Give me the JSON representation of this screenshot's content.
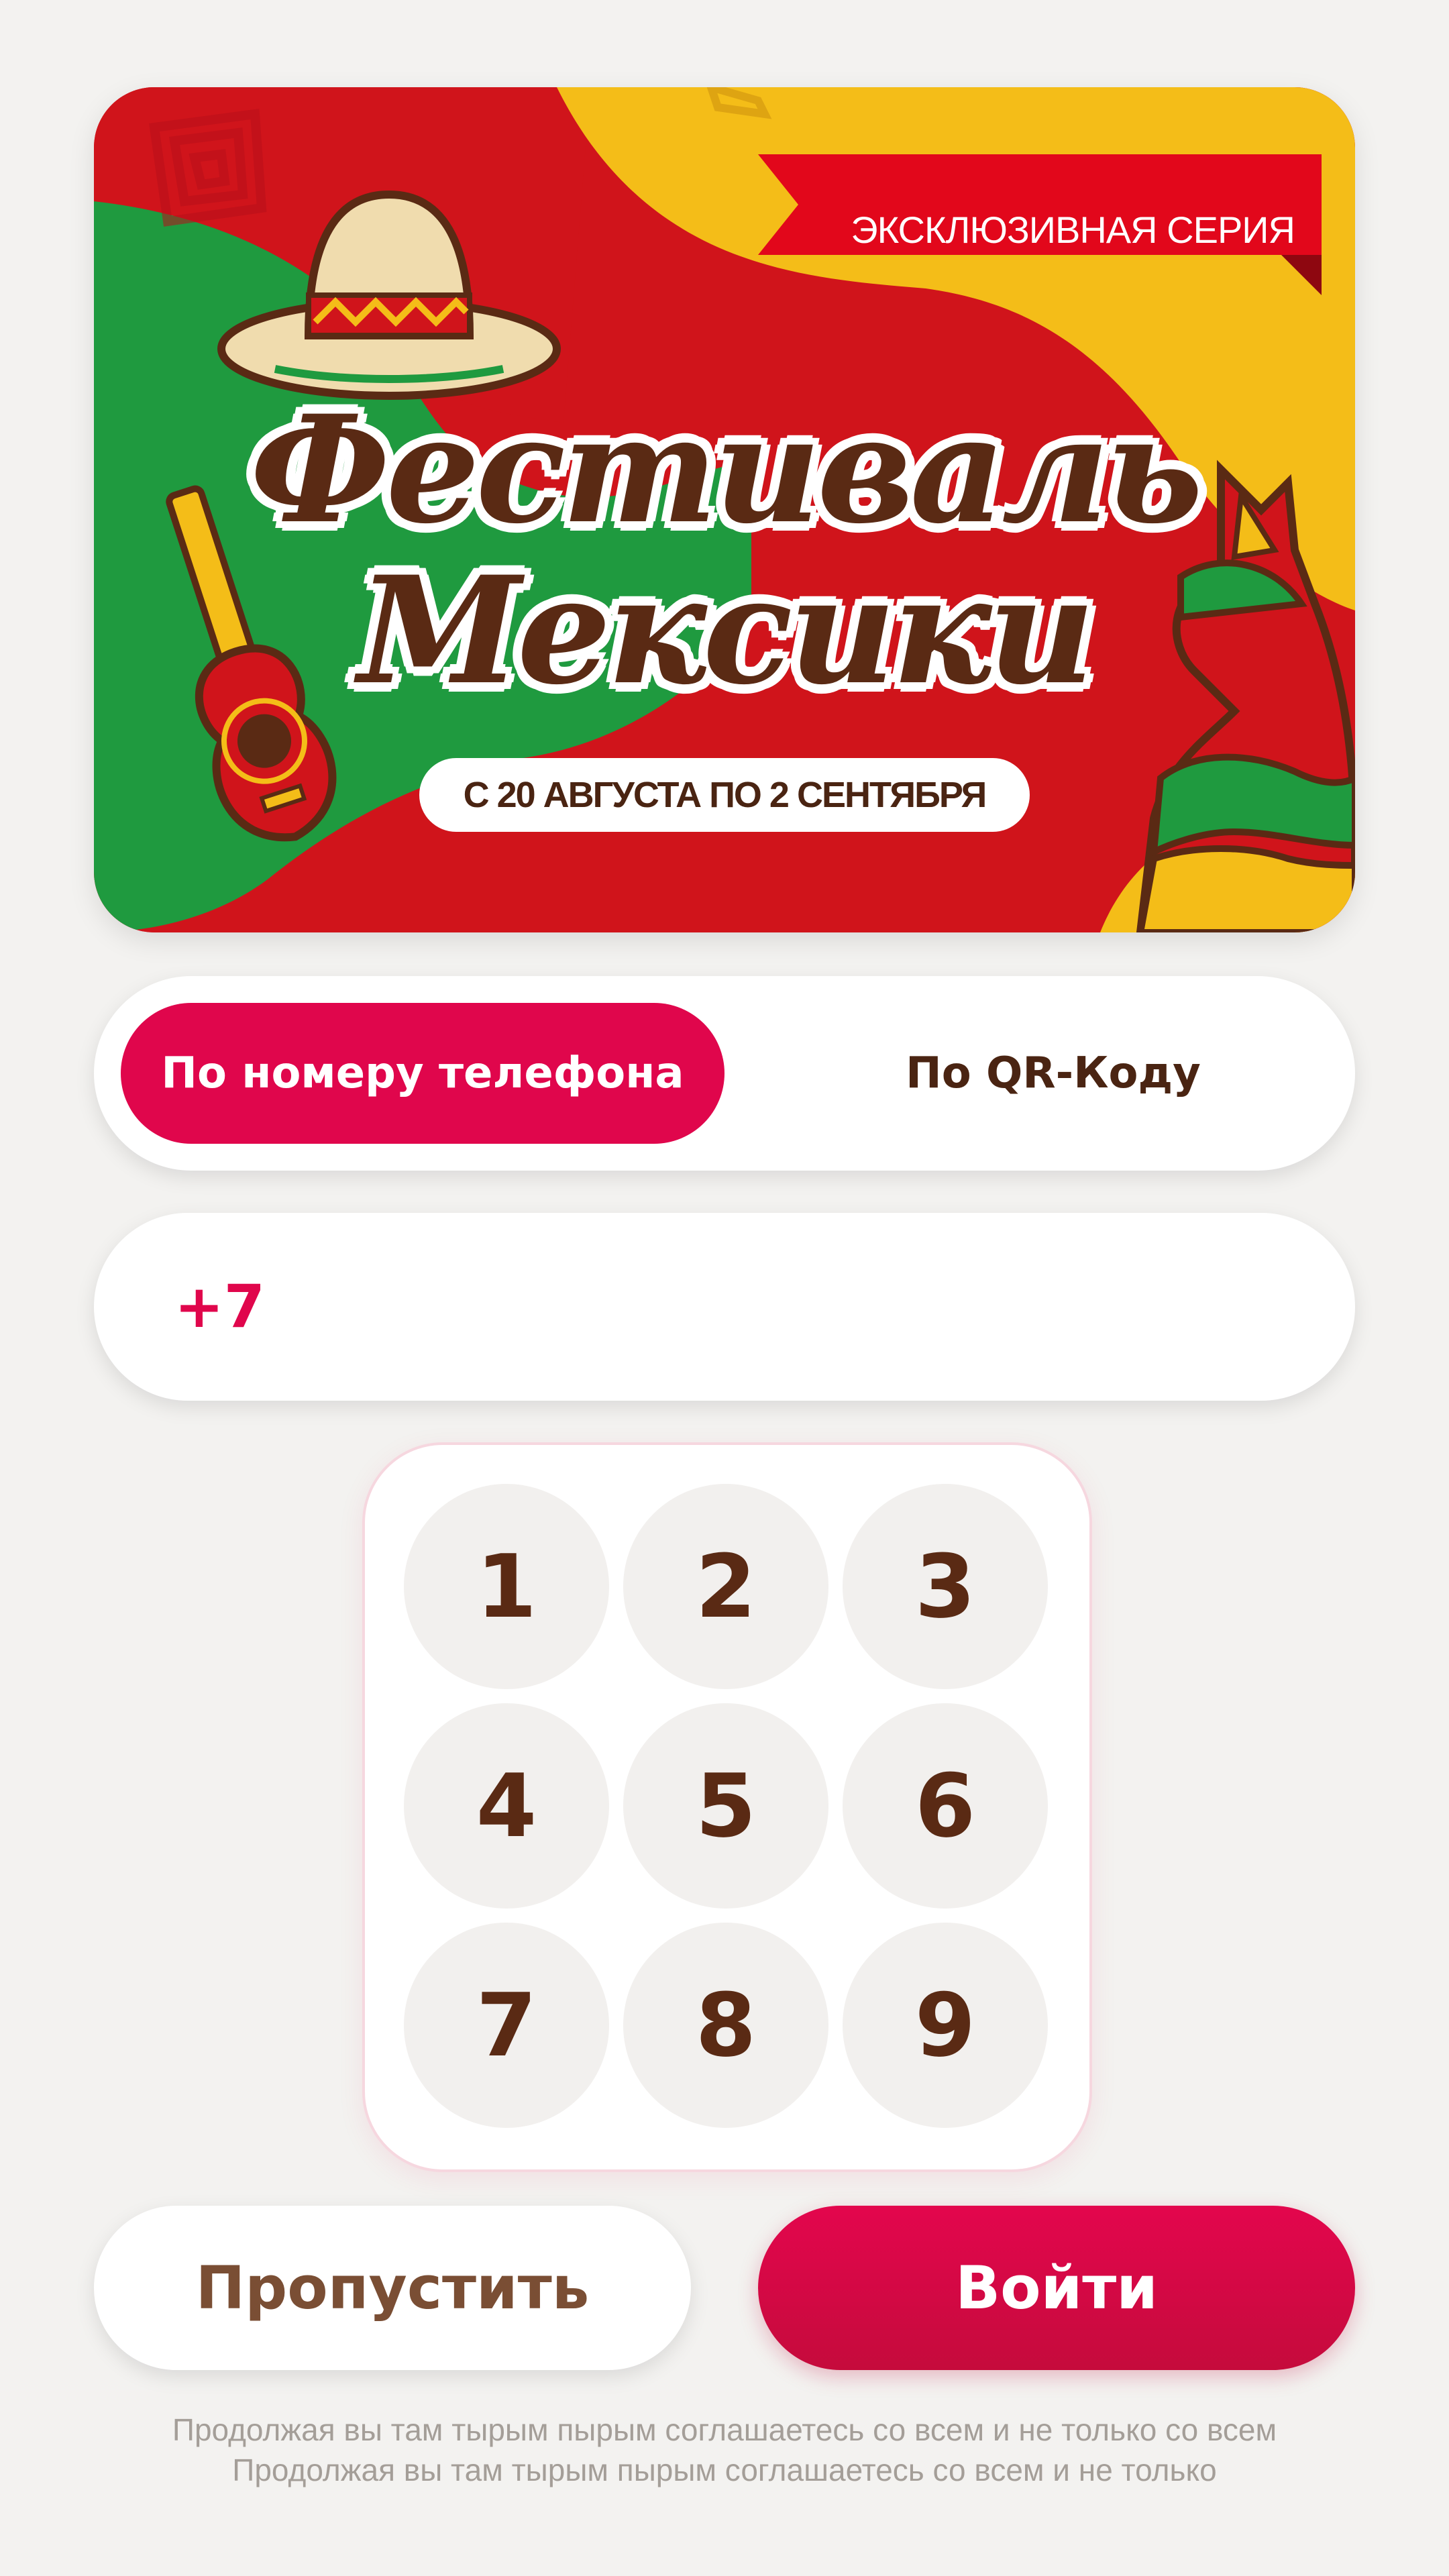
{
  "banner": {
    "ribbon_text": "ЭКСКЛЮЗИВНАЯ СЕРИЯ",
    "title_line1": "Фестиваль",
    "title_line2": "Мексики",
    "date_text": "С 20 АВГУСТА ПО 2 СЕНТЯБРЯ",
    "colors": {
      "red": "#d0141b",
      "green": "#1f9a3f",
      "yellow": "#f4bd18",
      "brown": "#5a2a14"
    },
    "icons": [
      "sombrero-icon",
      "guitar-icon",
      "llama-pinata-icon"
    ]
  },
  "tabs": {
    "phone_label": "По номеру телефона",
    "qr_label": "По QR-Коду",
    "active": "phone"
  },
  "phone": {
    "prefix": "+7",
    "value": ""
  },
  "keypad": {
    "keys": [
      "1",
      "2",
      "3",
      "4",
      "5",
      "6",
      "7",
      "8",
      "9"
    ]
  },
  "actions": {
    "skip_label": "Пропустить",
    "login_label": "Войти"
  },
  "legal": {
    "line1": "Продолжая вы там тырым пырым соглашаетесь со всем и не только со всем",
    "line2": "Продолжая вы там тырым пырым соглашаетесь со всем и не только"
  },
  "theme": {
    "accent": "#e0064c",
    "text_brown": "#4a2412",
    "background": "#f3f2f0"
  }
}
